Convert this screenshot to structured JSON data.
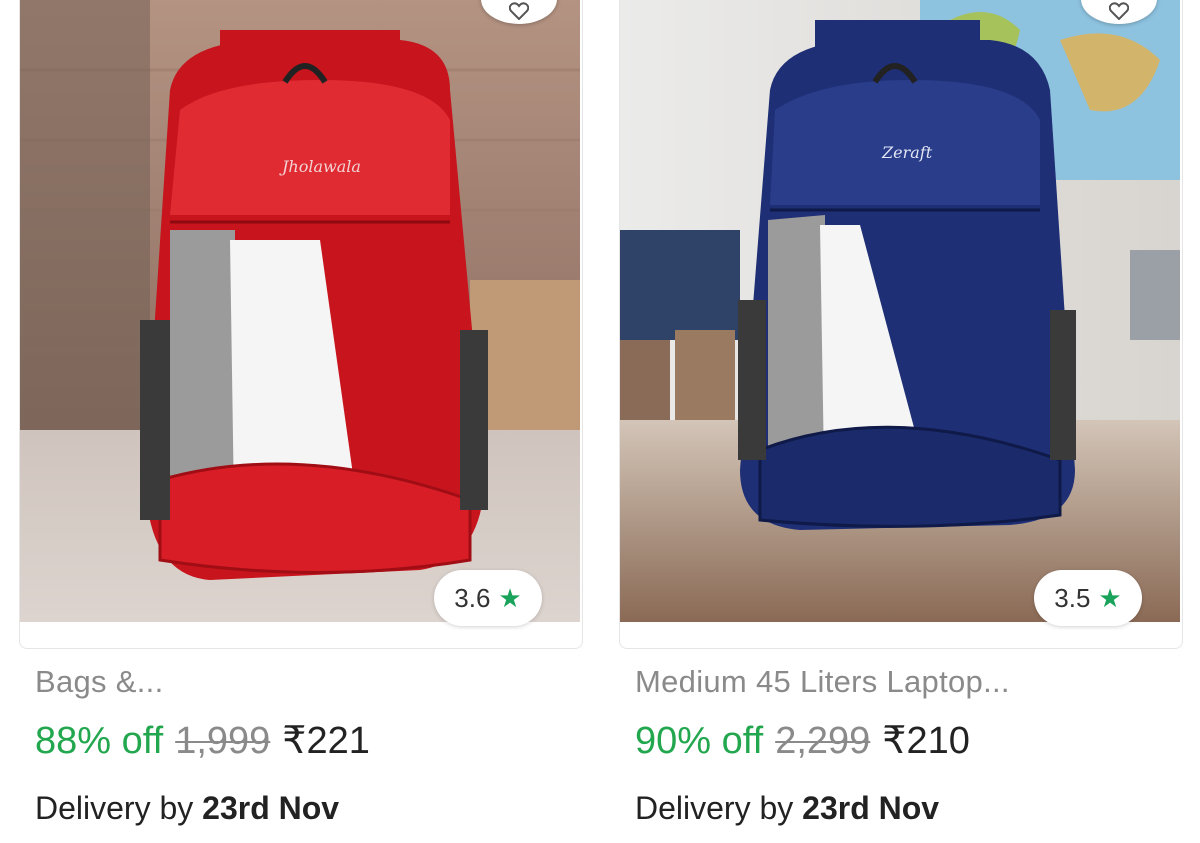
{
  "products": [
    {
      "title": "Bags &...",
      "discount": "88% off",
      "mrp": "1,999",
      "price": "₹221",
      "rating": "3.6",
      "delivery_prefix": "Delivery by",
      "delivery_date": "23rd Nov",
      "bag_color": "#d8222a",
      "brand_mark": "Jholawala"
    },
    {
      "title": "Medium 45 Liters Laptop...",
      "discount": "90% off",
      "mrp": "2,299",
      "price": "₹210",
      "rating": "3.5",
      "delivery_prefix": "Delivery by",
      "delivery_date": "23rd Nov",
      "bag_color": "#1f2f73",
      "brand_mark": "Zeraft"
    }
  ],
  "icons": {
    "wishlist": "heart-icon",
    "rating": "star-icon"
  },
  "colors": {
    "discount": "#22a74f",
    "star": "#1aa35b",
    "mrp": "#8a8a8a"
  }
}
